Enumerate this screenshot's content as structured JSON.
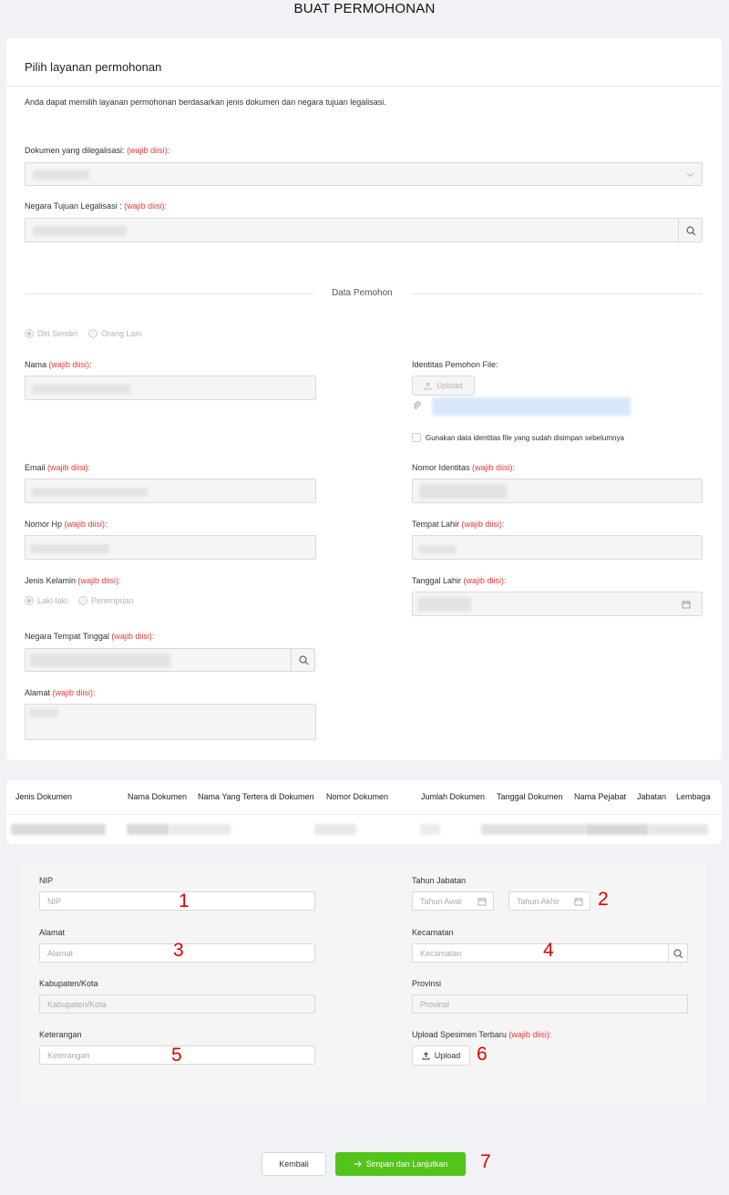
{
  "page_title": "BUAT PERMOHONAN",
  "service": {
    "card_title": "Pilih layanan permohonan",
    "intro": "Anda dapat memilih layanan permohonan berdasarkan jenis dokumen dan negara tujuan legalisasi.",
    "dokumen_label": "Dokumen yang dilegalisasi: ",
    "negara_label": "Negara Tujuan Legalisasi : ",
    "required": "(wajib diisi):"
  },
  "applicant": {
    "section_title": "Data Pemohon",
    "radio_self": "Diri Sendiri",
    "radio_other": "Orang Lain",
    "nama_label": "Nama ",
    "identitas_file_label": "Identitas Pemohon File:",
    "upload_label": "Upload",
    "reuse_checkbox_label": "Gunakan data identitas file yang sudah disimpan sebelumnya",
    "email_label": "Email ",
    "nomor_identitas_label": "Nomor Identitas ",
    "nomor_hp_label": "Nomor Hp ",
    "tempat_lahir_label": "Tempat Lahir ",
    "jenis_kelamin_label": "Jenis Kelamin ",
    "gender_male": "Laki-laki",
    "gender_female": "Perempuan",
    "tanggal_lahir_label": "Tanggal Lahir ",
    "negara_tinggal_label": "Negara Tempat Tinggal ",
    "alamat_label": "Alamat ",
    "required": "(wajib diisi):"
  },
  "table": {
    "headers": [
      "Jenis Dokumen",
      "Nama Dokumen",
      "Nama Yang Tertera di Dokumen",
      "Nomor Dokumen",
      "Jumlah Dokumen",
      "Tanggal Dokumen",
      "Nama Pejabat",
      "Jabatan",
      "Lembaga"
    ]
  },
  "official": {
    "nip_label": "NIP",
    "nip_placeholder": "NIP",
    "tahun_jabatan_label": "Tahun Jabatan",
    "tahun_awal_placeholder": "Tahun Awal",
    "tahun_akhir_placeholder": "Tahun Akhir",
    "alamat_label": "Alamat",
    "alamat_placeholder": "Alamat",
    "kecamatan_label": "Kecamatan",
    "kecamatan_placeholder": "Kecamatan",
    "kabupaten_label": "Kabupaten/Kota",
    "kabupaten_placeholder": "Kabupaten/Kota",
    "provinsi_label": "Provinsi",
    "provinsi_placeholder": "Provinsi",
    "keterangan_label": "Keterangan",
    "keterangan_placeholder": "Keterangan",
    "spesimen_label": "Upload Spesimen Terbaru ",
    "required": "(wajib diisi):",
    "upload_label": "Upload"
  },
  "annotations": [
    "1",
    "2",
    "3",
    "4",
    "5",
    "6",
    "7"
  ],
  "footer": {
    "back_label": "Kembali",
    "save_label": "Simpan dan Lanjutkan"
  },
  "colors": {
    "required": "#e53935",
    "primary_button": "#52c41a",
    "annotation": "#e00000"
  }
}
